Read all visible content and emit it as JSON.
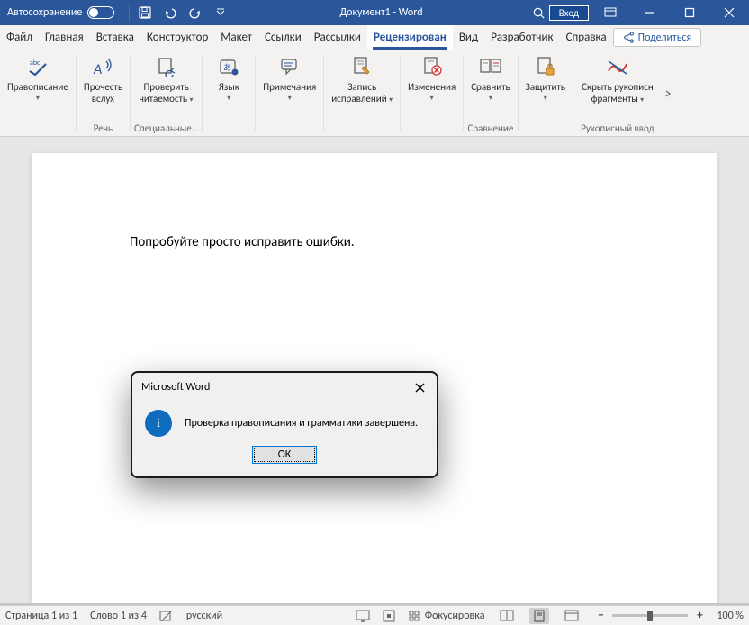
{
  "titlebar": {
    "autosave": "Автосохранение",
    "title": "Документ1  -  Word",
    "login": "Вход"
  },
  "tabs": {
    "file": "Файл",
    "home": "Главная",
    "insert": "Вставка",
    "design": "Конструктор",
    "layout": "Макет",
    "references": "Ссылки",
    "mailings": "Рассылки",
    "review": "Рецензирован",
    "view": "Вид",
    "developer": "Разработчик",
    "help": "Справка",
    "share": "Поделиться"
  },
  "ribbon": {
    "spelling": {
      "label1": "Правописание"
    },
    "readaloud": {
      "label1": "Прочесть",
      "label2": "вслух"
    },
    "accessibility": {
      "label1": "Проверить",
      "label2": "читаемость"
    },
    "language": {
      "label1": "Язык"
    },
    "comments": {
      "label1": "Примечания"
    },
    "tracking": {
      "label1": "Запись",
      "label2": "исправлений"
    },
    "changes": {
      "label1": "Изменения"
    },
    "compare": {
      "label1": "Сравнить"
    },
    "protect": {
      "label1": "Защитить"
    },
    "ink": {
      "label1": "Скрыть рукописн",
      "label2": "фрагменты"
    },
    "groups": {
      "speech": "Речь",
      "accessibility": "Специальные…",
      "compare": "Сравнение",
      "ink": "Рукописный ввод"
    }
  },
  "document": {
    "text": "Попробуйте просто исправить ошибки."
  },
  "dialog": {
    "title": "Microsoft Word",
    "message": "Проверка правописания и грамматики завершена.",
    "ok": "ОК"
  },
  "status": {
    "page": "Страница 1 из 1",
    "words": "Слово 1 из 4",
    "language": "русский",
    "focus": "Фокусировка",
    "zoom": "100 %"
  }
}
